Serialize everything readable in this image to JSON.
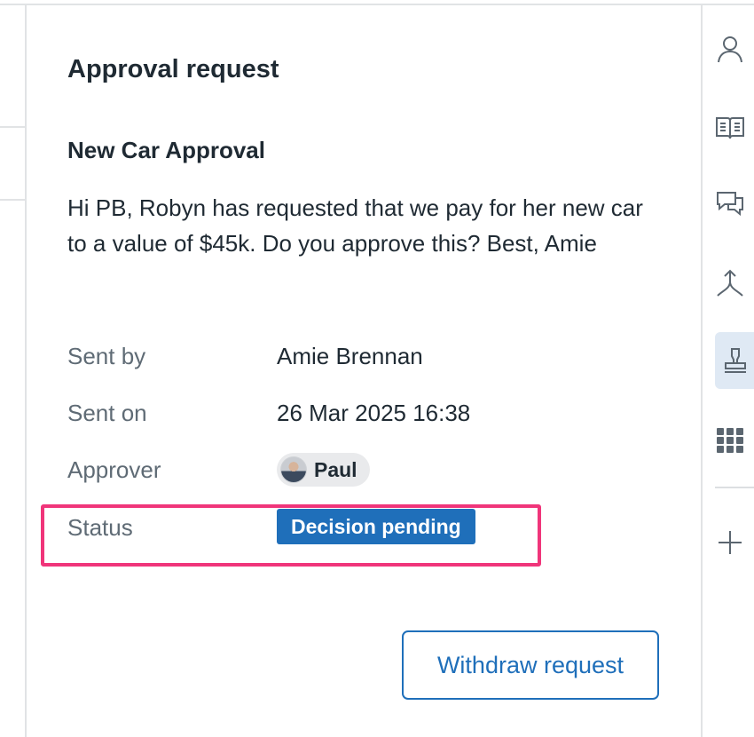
{
  "panel": {
    "title": "Approval request",
    "request_title": "New Car Approval",
    "request_body": "Hi PB, Robyn has requested that we pay for her new car to a value of $45k. Do you approve this? Best, Amie"
  },
  "details": {
    "sent_by_label": "Sent by",
    "sent_by_value": "Amie Brennan",
    "sent_on_label": "Sent on",
    "sent_on_value": "26 Mar 2025 16:38",
    "approver_label": "Approver",
    "approver_name": "Paul",
    "status_label": "Status",
    "status_value": "Decision pending"
  },
  "actions": {
    "withdraw_label": "Withdraw request"
  },
  "rail": {
    "icons": [
      "person-icon",
      "book-icon",
      "chat-icon",
      "merge-icon",
      "stamp-icon",
      "apps-grid-icon",
      "plus-icon"
    ],
    "active": "stamp-icon"
  },
  "colors": {
    "accent": "#1f6fba",
    "highlight": "#f0357a",
    "active_rail_bg": "#dfe9f4"
  }
}
